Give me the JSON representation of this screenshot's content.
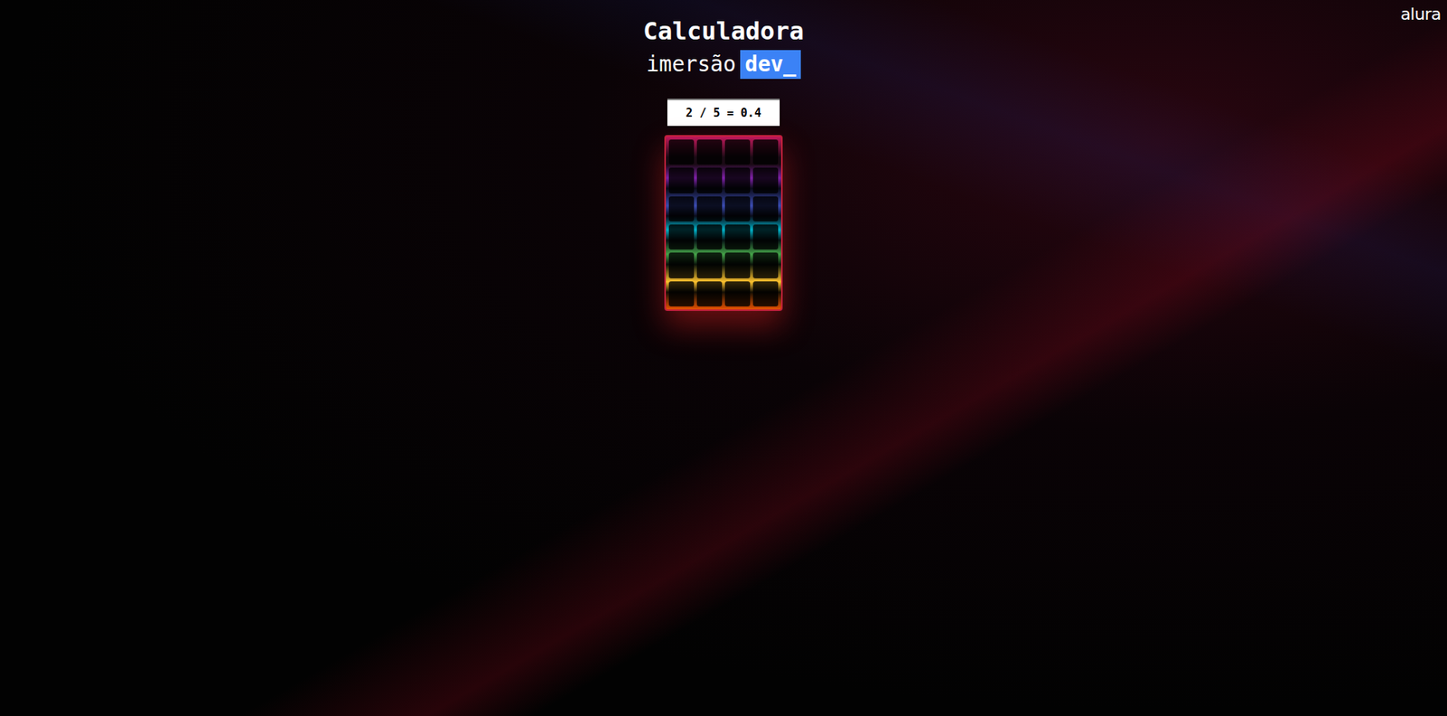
{
  "title": "Calculadora",
  "subtitle": {
    "prefix": "imersão",
    "highlight": "dev_"
  },
  "display": "2 / 5 = 0.4",
  "logo": "alura"
}
